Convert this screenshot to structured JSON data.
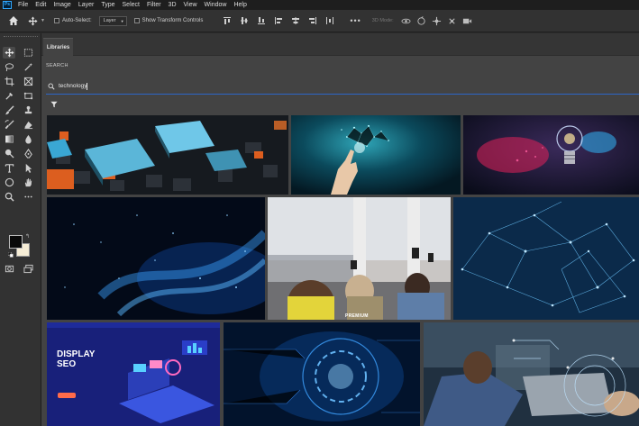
{
  "app": {
    "logo_text": "Ps"
  },
  "menu": [
    "File",
    "Edit",
    "Image",
    "Layer",
    "Type",
    "Select",
    "Filter",
    "3D",
    "View",
    "Window",
    "Help"
  ],
  "options_bar": {
    "auto_select_label": "Auto-Select:",
    "auto_select_value": "Layer",
    "show_transform_label": "Show Transform Controls",
    "mode_3d_label": "3D Mode:"
  },
  "swatches": {
    "foreground": "#0a0a0a",
    "background": "#f6edd6"
  },
  "panel": {
    "tab_label": "Libraries",
    "search_heading": "SEARCH",
    "search_value": "technology",
    "accent_color": "#2d66c8"
  },
  "results": {
    "premium_badge": "PREMIUM",
    "seo_title_line1": "DISPLAY",
    "seo_title_line2": "SEO"
  },
  "icons": [
    "home-icon",
    "move-icon",
    "search-icon",
    "filter-icon"
  ]
}
